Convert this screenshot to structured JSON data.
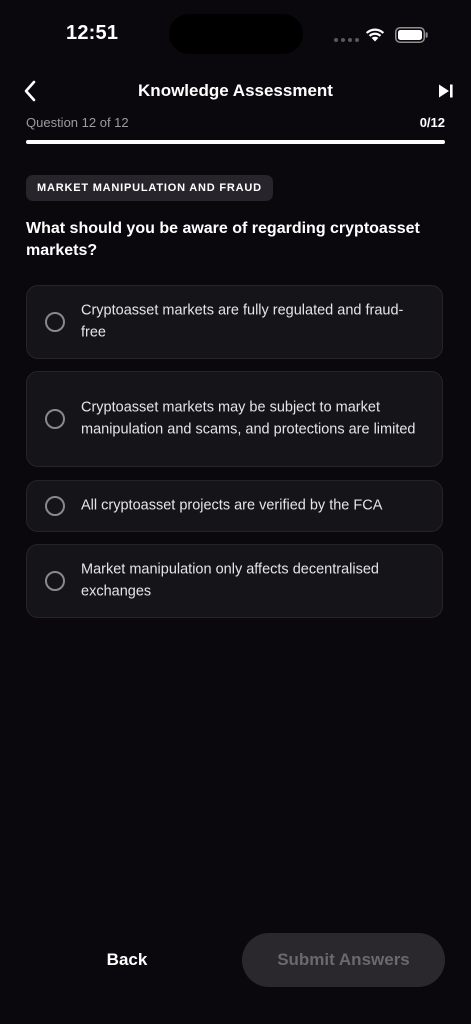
{
  "status_bar": {
    "time": "12:51",
    "icons": [
      "signal-dots",
      "wifi-icon",
      "battery-icon"
    ]
  },
  "header": {
    "title": "Knowledge Assessment",
    "back_icon": "chevron-left-icon",
    "skip_icon": "skip-forward-icon"
  },
  "progress": {
    "label": "Question 12 of 12",
    "count": "0/12",
    "fraction_answered": 0
  },
  "category": {
    "label": "MARKET MANIPULATION AND FRAUD"
  },
  "question": {
    "text": "What should you be aware of regarding cryptoasset markets?"
  },
  "options": [
    {
      "text": "Cryptoasset markets are fully regulated and fraud-free",
      "selected": false
    },
    {
      "text": "Cryptoasset markets may be subject to market manipulation and scams, and protections are limited",
      "selected": false
    },
    {
      "text": "All cryptoasset projects are verified by the FCA",
      "selected": false
    },
    {
      "text": "Market manipulation only affects decentralised exchanges",
      "selected": false
    }
  ],
  "footer": {
    "back_label": "Back",
    "submit_label": "Submit Answers",
    "submit_enabled": false
  },
  "colors": {
    "background": "#0b080d",
    "card": "#151418",
    "badge": "#27252b",
    "submit_disabled_bg": "#2a282c",
    "submit_disabled_text": "#6b686f",
    "muted_text": "#9d9aa2"
  }
}
